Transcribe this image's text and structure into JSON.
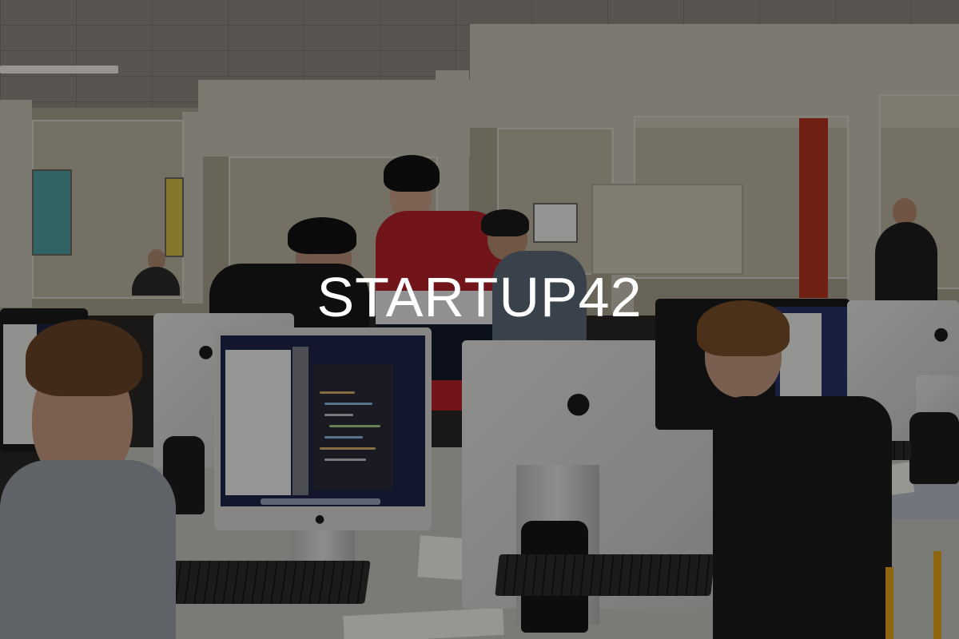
{
  "headline": "STARTUP42",
  "colors": {
    "overlay": "#000000",
    "headline_text": "#ffffff",
    "accent_wall": "#b5351f",
    "chair": "#e5a41b"
  },
  "scene": {
    "description_icon": "photo-classroom-computers"
  }
}
